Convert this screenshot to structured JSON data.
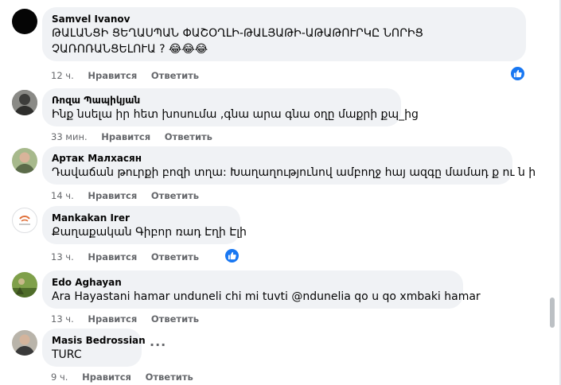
{
  "colors": {
    "accent": "#1877f2",
    "bubble": "#f0f2f5",
    "meta": "#65676b"
  },
  "action_labels": {
    "like": "Нравится",
    "reply": "Ответить"
  },
  "comments": [
    {
      "author": "Samvel Ivanov",
      "lines": [
        "ԹԱԼԱՆՑԻ ՑԵՂԱՍՊԱՆ ՓԱՇՕՂԼԻ-ԹԱԼՅԱԹԻ-ԱԹԱԹՈՒՐԿԸ ՆՈՐԻՑ",
        "ՉԱՌՈՌԱՆՑԵԼՈՒԱ ? 😂😂😂"
      ],
      "time": "12 ч.",
      "avatar_icon": "dark-avatar-icon",
      "has_like": true
    },
    {
      "author": "Ռոզա Պապիկյան",
      "lines": [
        "Ինք նսելա իր հետ խոսումա ,գնա արա գնա օղը մաքրի քպ_ից"
      ],
      "time": "33 мин.",
      "avatar_icon": "person-avatar-icon",
      "has_like": false
    },
    {
      "author": "Артак Малхасян",
      "lines": [
        "Դավաճան թուրքի բոզի տղա: Խաղաղությունով ամբողջ հայ ազգը մամադ ք ու ն ի"
      ],
      "time": "14 ч.",
      "avatar_icon": "person-avatar-icon",
      "has_like": false
    },
    {
      "author": "Mankakan Irer",
      "lines": [
        "Քաղաքական Գիբոր ռադ Էղի Էլի"
      ],
      "time": "13 ч.",
      "avatar_icon": "logo-avatar-icon",
      "has_like": true
    },
    {
      "author": "Edo Aghayan",
      "lines": [
        "Ara Hayastani hamar unduneli chi mi tuvti @ndunelia qo u qo xmbaki hamar"
      ],
      "time": "13 ч.",
      "avatar_icon": "landscape-avatar-icon",
      "has_like": false
    },
    {
      "author": "Masis Bedrossian",
      "lines": [
        "TURC"
      ],
      "time": "9 ч.",
      "avatar_icon": "person-avatar-icon",
      "has_like": false
    }
  ],
  "more_options_icon": "more-options-icon",
  "like_icon": "thumbs-up-icon"
}
